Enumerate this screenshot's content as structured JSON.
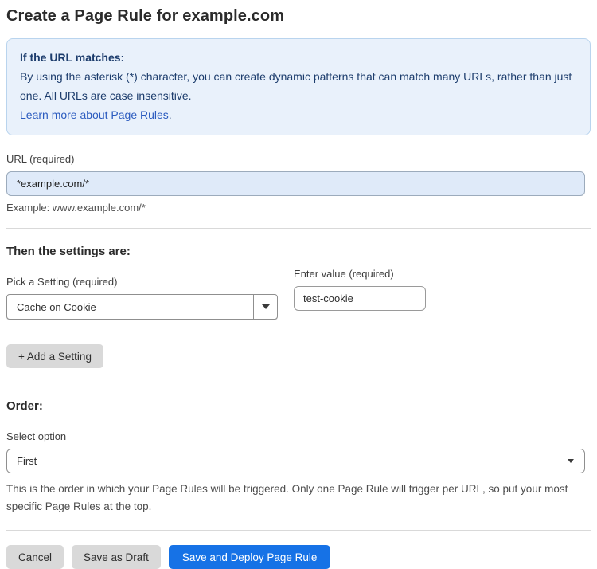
{
  "page": {
    "title": "Create a Page Rule for example.com"
  },
  "info_box": {
    "heading": "If the URL matches:",
    "body": "By using the asterisk (*) character, you can create dynamic patterns that can match many URLs, rather than just one. All URLs are case insensitive.",
    "link_text": "Learn more about Page Rules",
    "link_suffix": "."
  },
  "url_field": {
    "label": "URL (required)",
    "value": "*example.com/*",
    "example": "Example: www.example.com/*"
  },
  "settings": {
    "heading": "Then the settings are:",
    "setting_label": "Pick a Setting (required)",
    "setting_selected": "Cache on Cookie",
    "value_label": "Enter value (required)",
    "value": "test-cookie",
    "add_button_label": "+ Add a Setting"
  },
  "order": {
    "heading": "Order:",
    "label": "Select option",
    "selected": "First",
    "help": "This is the order in which your Page Rules will be triggered. Only one Page Rule will trigger per URL, so put your most specific Page Rules at the top."
  },
  "actions": {
    "cancel_label": "Cancel",
    "save_draft_label": "Save as Draft",
    "save_deploy_label": "Save and Deploy Page Rule"
  },
  "colors": {
    "accent_blue": "#1672e6",
    "info_box_bg": "#e9f1fb",
    "info_box_border": "#b9d4ee",
    "info_text": "#1d3d6d",
    "link_blue": "#2b5bbf",
    "url_input_bg": "#dfeaf9",
    "gray_button_bg": "#d9d9d9"
  }
}
